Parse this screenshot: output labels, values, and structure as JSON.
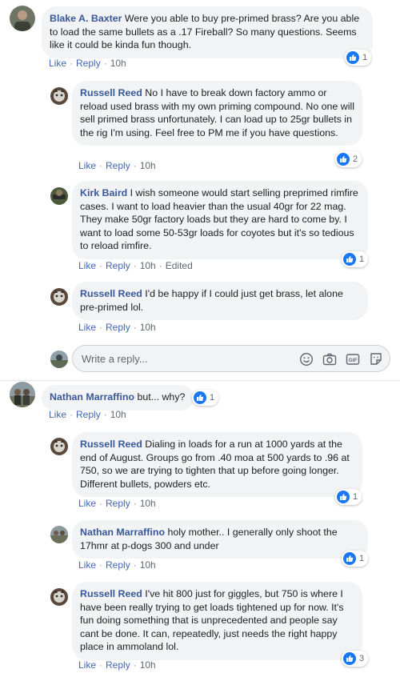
{
  "comments": [
    {
      "author": "Blake A. Baxter",
      "text": "Were you able to buy pre-primed brass? Are you able to load the same bullets as a .17 Fireball? So many questions. Seems like it could be kinda fun though.",
      "like_label": "Like",
      "reply_label": "Reply",
      "time": "10h",
      "reactions": "1"
    },
    {
      "author": "Russell Reed",
      "text": "No I have to break down factory ammo or reload used brass with my own priming compound. No one will sell primed brass unfortunately. I can load up to 25gr bullets in the rig I'm using. Feel free to PM me if you have questions.",
      "like_label": "Like",
      "reply_label": "Reply",
      "time": "10h",
      "reactions": "2"
    },
    {
      "author": "Kirk Baird",
      "text": "I wish someone would start selling preprimed rimfire cases. I want to load heavier than the usual 40gr for 22 mag. They make 50gr factory loads but they are hard to come by. I want to load some 50-53gr loads for coyotes but it's so tedious to reload rimfire.",
      "like_label": "Like",
      "reply_label": "Reply",
      "time": "10h",
      "edited": "Edited",
      "reactions": "1"
    },
    {
      "author": "Russell Reed",
      "text": "I'd be happy if I could just get brass, let alone pre-primed lol.",
      "like_label": "Like",
      "reply_label": "Reply",
      "time": "10h"
    },
    {
      "author": "Nathan Marraffino",
      "text": "but... why?",
      "like_label": "Like",
      "reply_label": "Reply",
      "time": "10h",
      "reactions": "1"
    },
    {
      "author": "Russell Reed",
      "text": "Dialing in loads for a run at 1000 yards at the end of August. Groups go from .40 moa at 500 yards to .96 at 750, so we are trying to tighten that up before going longer. Different bullets, powders etc.",
      "like_label": "Like",
      "reply_label": "Reply",
      "time": "10h",
      "reactions": "1"
    },
    {
      "author": "Nathan Marraffino",
      "text": "holy mother.. I generally only shoot the 17hmr at p-dogs 300 and under",
      "like_label": "Like",
      "reply_label": "Reply",
      "time": "10h",
      "reactions": "1"
    },
    {
      "author": "Russell Reed",
      "text": "I've hit 800 just for giggles, but 750 is where I have been really trying to get loads tightened up for now. It's fun doing something that is unprecedented and people say cant be done. It can, repeatedly, just needs the right happy place in ammoland lol.",
      "like_label": "Like",
      "reply_label": "Reply",
      "time": "10h",
      "reactions": "3"
    }
  ],
  "reply_box": {
    "placeholder": "Write a reply..."
  },
  "colors": {
    "author": "#385898",
    "link": "#4267b2",
    "bubble": "#f2f3f5",
    "like_blue": "#1877f2"
  },
  "icons": [
    "like-icon",
    "emoji-icon",
    "camera-icon",
    "gif-icon",
    "sticker-icon"
  ]
}
